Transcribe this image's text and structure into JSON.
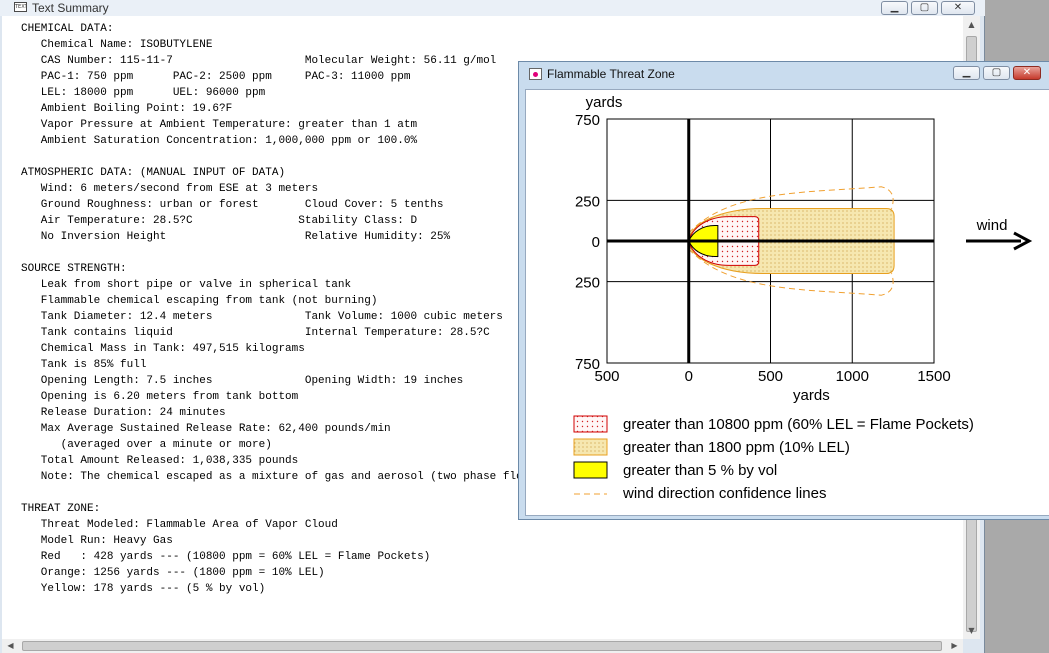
{
  "text_summary": {
    "title": "Text Summary",
    "title_icon": "TEXT",
    "buttons": {
      "minimize": "▁",
      "maximize": "▢",
      "close": "✕"
    },
    "scroll_arrows": {
      "up": "▲",
      "down": "▼",
      "left": "◀",
      "right": "▶"
    },
    "lines": [
      "CHEMICAL DATA:",
      "   Chemical Name: ISOBUTYLENE",
      "   CAS Number: 115-11-7                    Molecular Weight: 56.11 g/mol",
      "   PAC-1: 750 ppm      PAC-2: 2500 ppm     PAC-3: 11000 ppm",
      "   LEL: 18000 ppm      UEL: 96000 ppm",
      "   Ambient Boiling Point: 19.6?F",
      "   Vapor Pressure at Ambient Temperature: greater than 1 atm",
      "   Ambient Saturation Concentration: 1,000,000 ppm or 100.0%",
      "",
      "ATMOSPHERIC DATA: (MANUAL INPUT OF DATA)",
      "   Wind: 6 meters/second from ESE at 3 meters",
      "   Ground Roughness: urban or forest       Cloud Cover: 5 tenths",
      "   Air Temperature: 28.5?C                Stability Class: D",
      "   No Inversion Height                     Relative Humidity: 25%",
      "",
      "SOURCE STRENGTH:",
      "   Leak from short pipe or valve in spherical tank",
      "   Flammable chemical escaping from tank (not burning)",
      "   Tank Diameter: 12.4 meters              Tank Volume: 1000 cubic meters",
      "   Tank contains liquid                    Internal Temperature: 28.5?C",
      "   Chemical Mass in Tank: 497,515 kilograms",
      "   Tank is 85% full",
      "   Opening Length: 7.5 inches              Opening Width: 19 inches",
      "   Opening is 6.20 meters from tank bottom",
      "   Release Duration: 24 minutes",
      "   Max Average Sustained Release Rate: 62,400 pounds/min",
      "      (averaged over a minute or more)",
      "   Total Amount Released: 1,038,335 pounds",
      "   Note: The chemical escaped as a mixture of gas and aerosol (two phase flow).",
      "",
      "THREAT ZONE:",
      "   Threat Modeled: Flammable Area of Vapor Cloud",
      "   Model Run: Heavy Gas",
      "   Red   : 428 yards --- (10800 ppm = 60% LEL = Flame Pockets)",
      "   Orange: 1256 yards --- (1800 ppm = 10% LEL)",
      "   Yellow: 178 yards --- (5 % by vol)"
    ]
  },
  "threat_zone": {
    "title": "Flammable Threat Zone",
    "buttons": {
      "minimize": "▁",
      "maximize": "▢",
      "close": "✕"
    },
    "wind_label": "wind",
    "legend": [
      {
        "label": "greater than 10800 ppm (60% LEL = Flame Pockets)",
        "color": "#d00000",
        "fill": "dots-red"
      },
      {
        "label": "greater than 1800 ppm (10% LEL)",
        "color": "#e8a020",
        "fill": "dots-tan"
      },
      {
        "label": "greater than 5 % by vol",
        "color": "#ffff00",
        "fill": "solid"
      },
      {
        "label": "wind direction confidence lines",
        "color": "#f0a030",
        "fill": "dash"
      }
    ]
  },
  "chart_data": {
    "type": "area",
    "title": "",
    "xlabel": "yards",
    "ylabel": "yards",
    "xlim": [
      -500,
      1500
    ],
    "ylim": [
      -750,
      750
    ],
    "x_ticks": [
      -500,
      0,
      500,
      1000,
      1500
    ],
    "x_tick_labels": [
      "500",
      "0",
      "500",
      "1000",
      "1500"
    ],
    "y_ticks": [
      750,
      250,
      0,
      -250,
      -750
    ],
    "y_tick_labels": [
      "750",
      "250",
      "0",
      "250",
      "750"
    ],
    "grid": true,
    "zones": [
      {
        "name": "Red",
        "threshold": "10800 ppm",
        "extent_yards": 428,
        "half_width_yards": 150
      },
      {
        "name": "Orange",
        "threshold": "1800 ppm",
        "extent_yards": 1256,
        "half_width_yards": 200
      },
      {
        "name": "Yellow",
        "threshold": "5 % by vol",
        "extent_yards": 178,
        "half_width_yards": 95
      }
    ],
    "confidence_lines": {
      "extent_yards": 1240,
      "half_width_yards": 370
    }
  }
}
